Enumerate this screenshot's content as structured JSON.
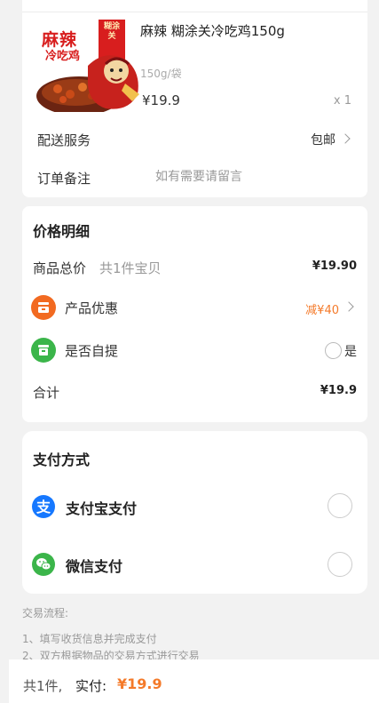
{
  "product": {
    "title": "麻辣 糊涂关冷吃鸡150g",
    "spec": "150g/袋",
    "price": "¥19.9",
    "quantity": "x 1",
    "image_label_main": "麻辣",
    "image_label_sub": "冷吃鸡",
    "image_brand": "糊涂关"
  },
  "shipping": {
    "label": "配送服务",
    "value": "包邮"
  },
  "note": {
    "label": "订单备注",
    "placeholder": "如有需要请留言"
  },
  "price_detail": {
    "title": "价格明细",
    "goods_label": "商品总价",
    "goods_count": "共1件宝贝",
    "goods_total": "¥19.90",
    "discount_label": "产品优惠",
    "discount_value": "减¥40",
    "pickup_label": "是否自提",
    "pickup_option": "是",
    "sum_label": "合计",
    "sum_value": "¥19.9"
  },
  "payment": {
    "title": "支付方式",
    "methods": [
      {
        "label": "支付宝支付",
        "icon": "alipay-icon",
        "color": "#1678ff"
      },
      {
        "label": "微信支付",
        "icon": "wechat-icon",
        "color": "#3bb54a"
      }
    ]
  },
  "flow": {
    "title": "交易流程:",
    "steps": [
      "1、填写收货信息并完成支付",
      "2、双方根据物品的交易方式进行交易"
    ]
  },
  "footer": {
    "count": "共1件,",
    "paid_label": "实付:",
    "amount": "¥19.9"
  },
  "colors": {
    "accent": "#f47a2a",
    "discount_icon": "#f26a21",
    "pickup_icon": "#3bb54a",
    "background": "#f2f2f2"
  }
}
